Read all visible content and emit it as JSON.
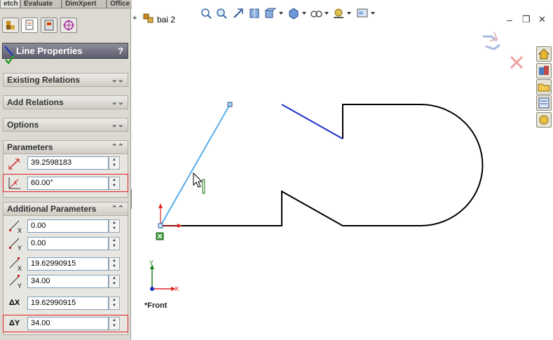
{
  "command_tabs": [
    "etch",
    "Evaluate",
    "DimXpert",
    "Office Products"
  ],
  "panel": {
    "title": "Line Properties",
    "help": "?",
    "confirm_icon": "checkmark-icon",
    "sections": {
      "existing_relations": "Existing Relations",
      "add_relations": "Add Relations",
      "options": "Options",
      "parameters": "Parameters",
      "additional_parameters": "Additional Parameters"
    },
    "parameters": {
      "length": "39.2598183",
      "angle": "60.00°"
    },
    "additional": {
      "start_x": "0.00",
      "start_y": "0.00",
      "end_x": "19.62990915",
      "end_y": "34.00",
      "delta_x": "19.62990915",
      "delta_y": "34.00"
    },
    "labels": {
      "x": "X",
      "y": "Y",
      "dx": "ΔX",
      "dy": "ΔY"
    }
  },
  "tree": {
    "expand": "+",
    "part_name": "bai 2"
  },
  "window_controls": {
    "minimize": "–",
    "restore": "❐",
    "close": "✕"
  },
  "view": {
    "name": "*Front",
    "axis_x": "X",
    "axis_y": "Y"
  },
  "colors": {
    "selected_line": "#5aaeea",
    "blue_line": "#1a2fc8",
    "profile": "#000000",
    "highlight_box": "#d22222"
  }
}
